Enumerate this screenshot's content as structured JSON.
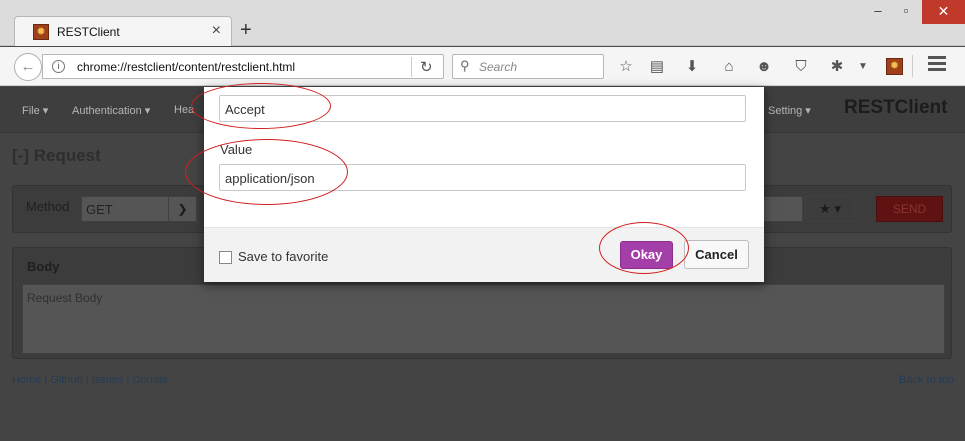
{
  "browser": {
    "tab_title": "RESTClient",
    "tab_close": "×",
    "new_tab": "+",
    "window_controls": {
      "minimize": "–",
      "maximize": "▫",
      "close": "✕"
    },
    "url": "chrome://restclient/content/restclient.html",
    "search_placeholder": "Search",
    "toolbar_icons": [
      "star-icon",
      "reading-list-icon",
      "download-icon",
      "home-icon",
      "smiley-icon",
      "pocket-icon",
      "bug-icon",
      "dropdown-icon",
      "restclient-icon",
      "menu-icon"
    ]
  },
  "app": {
    "nav": {
      "file": "File ▾",
      "authentication": "Authentication ▾",
      "headers": "Hea",
      "setting": "Setting ▾"
    },
    "brand": "RESTClient",
    "request_title": "[-] Request",
    "method_label": "Method",
    "method_value": "GET",
    "send_label": "SEND",
    "body_title": "Body",
    "body_placeholder": "Request Body",
    "footer_links": "Home | Github | Issues | Donate",
    "back_to_top": "Back to top"
  },
  "modal": {
    "name_value": "Accept",
    "value_label": "Value",
    "value_value": "application/json",
    "save_favorite_label": "Save to favorite",
    "save_favorite_checked": false,
    "okay_label": "Okay",
    "cancel_label": "Cancel"
  },
  "colors": {
    "annotation": "#d21f1f",
    "okay_button": "#a43ea8",
    "send_button": "#5e1212"
  }
}
